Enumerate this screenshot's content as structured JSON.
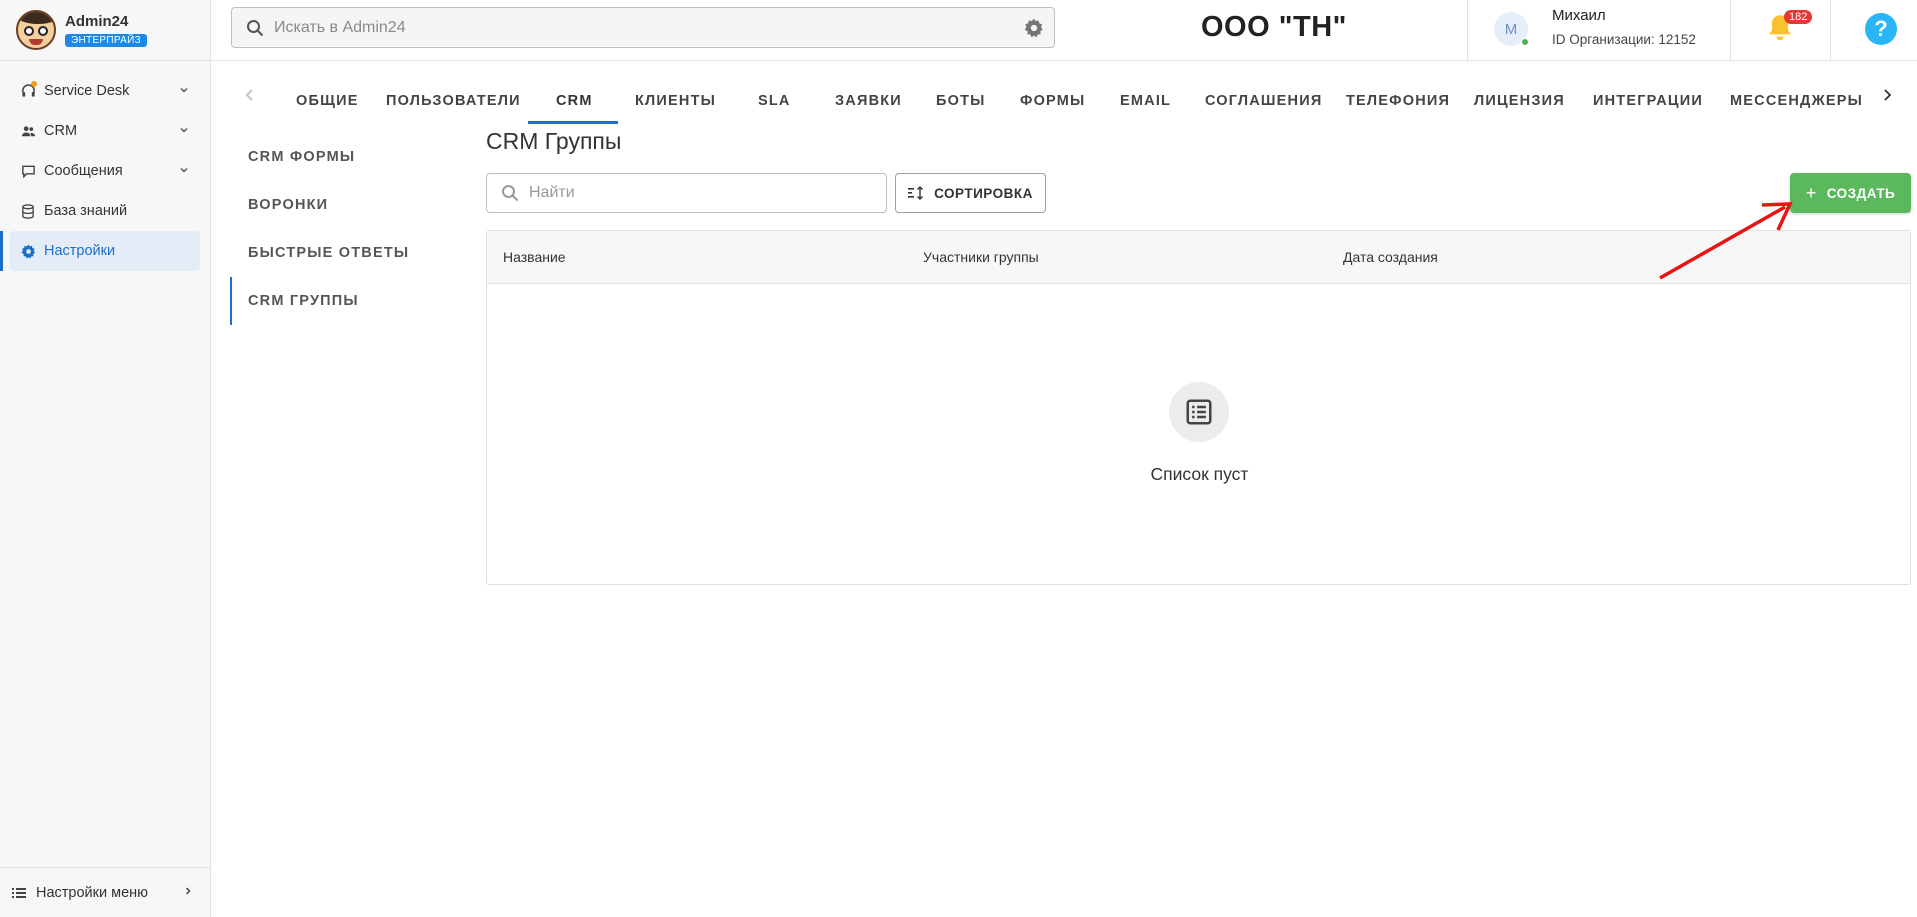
{
  "brand": {
    "name": "Admin24",
    "badge": "ЭНТЕРПРАЙЗ"
  },
  "sidebar": {
    "items": [
      {
        "label": "Service Desk",
        "icon": "headset-icon",
        "has_chevron": true
      },
      {
        "label": "CRM",
        "icon": "people-icon",
        "has_chevron": true
      },
      {
        "label": "Сообщения",
        "icon": "chat-icon",
        "has_chevron": true
      },
      {
        "label": "База знаний",
        "icon": "database-icon",
        "has_chevron": false
      },
      {
        "label": "Настройки",
        "icon": "gear-icon",
        "has_chevron": false,
        "active": true
      }
    ],
    "footer_label": "Настройки меню"
  },
  "header": {
    "search_placeholder": "Искать в Admin24",
    "org_title": "ООО \"ТН\"",
    "user": {
      "initial": "М",
      "name": "Михаил",
      "org_id": "ID Организации: 12152"
    },
    "notifications_count": "182",
    "help_label": "?"
  },
  "tabs": [
    {
      "label": "ОБЩИЕ"
    },
    {
      "label": "ПОЛЬЗОВАТЕЛИ"
    },
    {
      "label": "CRM",
      "active": true
    },
    {
      "label": "КЛИЕНТЫ"
    },
    {
      "label": "SLA"
    },
    {
      "label": "ЗАЯВКИ"
    },
    {
      "label": "БОТЫ"
    },
    {
      "label": "ФОРМЫ"
    },
    {
      "label": "EMAIL"
    },
    {
      "label": "СОГЛАШЕНИЯ"
    },
    {
      "label": "ТЕЛЕФОНИЯ"
    },
    {
      "label": "ЛИЦЕНЗИЯ"
    },
    {
      "label": "ИНТЕГРАЦИИ"
    },
    {
      "label": "МЕССЕНДЖЕРЫ"
    }
  ],
  "subnav": [
    {
      "label": "CRM ФОРМЫ"
    },
    {
      "label": "ВОРОНКИ"
    },
    {
      "label": "БЫСТРЫЕ ОТВЕТЫ"
    },
    {
      "label": "CRM ГРУППЫ",
      "active": true
    }
  ],
  "main": {
    "title": "CRM Группы",
    "search_placeholder": "Найти",
    "sort_label": "СОРТИРОВКА",
    "create_label": "СОЗДАТЬ",
    "table": {
      "columns": [
        "Название",
        "Участники группы",
        "Дата создания"
      ],
      "rows": [],
      "empty_text": "Список пуст"
    }
  },
  "colors": {
    "accent": "#1e6fc7",
    "create_button": "#5cb85c",
    "badge": "#e53935",
    "annotation_arrow": "#e81313"
  }
}
